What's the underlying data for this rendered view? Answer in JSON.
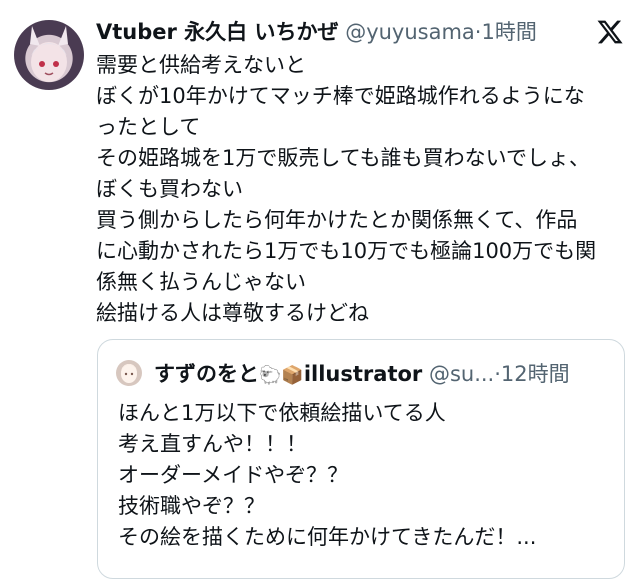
{
  "tweet": {
    "display_name": "Vtuber 永久白 いちかぜ",
    "handle": "@yuyusama",
    "separator": "·",
    "time": "1時間",
    "lines": [
      "需要と供給考えないと",
      "ぼくが10年かけてマッチ棒で姫路城作れるようにな",
      "ったとして",
      "その姫路城を1万で販売しても誰も買わないでしょ、",
      "ぼくも買わない",
      "買う側からしたら何年かけたとか関係無くて、作品",
      "に心動かされたら1万でも10万でも極論100万でも関",
      "係無く払うんじゃない",
      "絵描ける人は尊敬するけどね"
    ]
  },
  "quote": {
    "display_name": "すずのをと",
    "emojis": "🐑📦",
    "name_suffix": "illustrator",
    "handle": "@su...",
    "separator": "·",
    "time": "12時間",
    "lines": [
      "ほんと1万以下で依頼絵描いてる人",
      "考え直すんや！！！",
      "オーダーメイドやぞ？？",
      "技術職やぞ？？",
      "その絵を描くために何年かけてきたんだ！..."
    ]
  },
  "icons": {
    "brand": "x-logo-icon"
  },
  "colors": {
    "text": "#0f1419",
    "secondary": "#536471",
    "border": "#cfd9de"
  }
}
